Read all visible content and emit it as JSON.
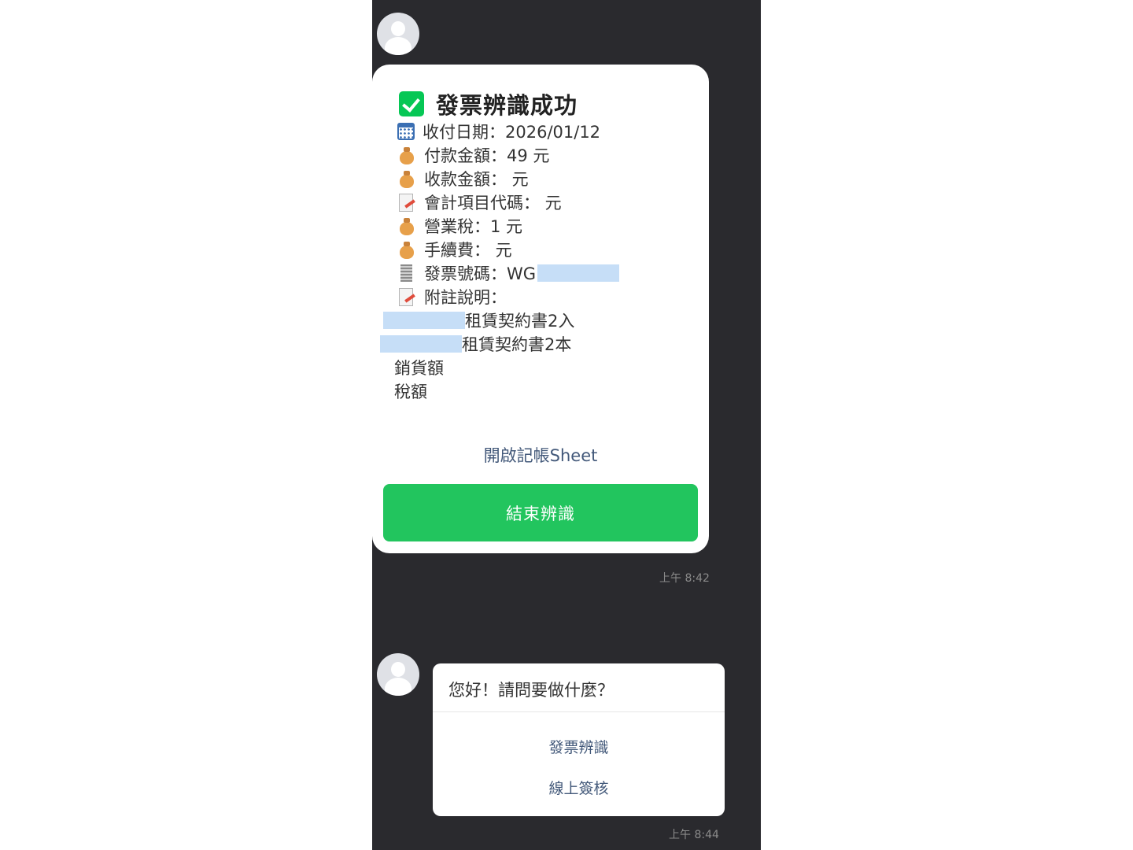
{
  "chat": {
    "message_1": {
      "title": "發票辨識成功",
      "fields": [
        {
          "icon": "calendar-icon",
          "text": "收付日期：2026/01/12"
        },
        {
          "icon": "money-bag-icon",
          "text": "付款金額：49 元"
        },
        {
          "icon": "money-bag-icon",
          "text": "收款金額： 元"
        },
        {
          "icon": "memo-icon",
          "text": "會計項目代碼： 元"
        },
        {
          "icon": "money-bag-icon",
          "text": "營業稅：1 元"
        },
        {
          "icon": "money-bag-icon",
          "text": "手續費： 元"
        },
        {
          "icon": "receipt-icon",
          "text": "發票號碼：WG"
        },
        {
          "icon": "memo-icon",
          "text": "附註說明："
        }
      ],
      "note_lines": [
        "租賃契約書2入",
        "租賃契約書2本",
        "銷貨額",
        "稅額"
      ],
      "link_label": "開啟記帳Sheet",
      "button_label": "結束辨識",
      "time": "上午 8:42"
    },
    "message_2": {
      "question": "您好！請問要做什麼？",
      "actions": [
        "發票辨識",
        "線上簽核"
      ],
      "time": "上午 8:44"
    }
  },
  "colors": {
    "background": "#2a2a2e",
    "accent_green": "#22c55e",
    "link": "#43597a",
    "redaction": "#c6def7"
  }
}
